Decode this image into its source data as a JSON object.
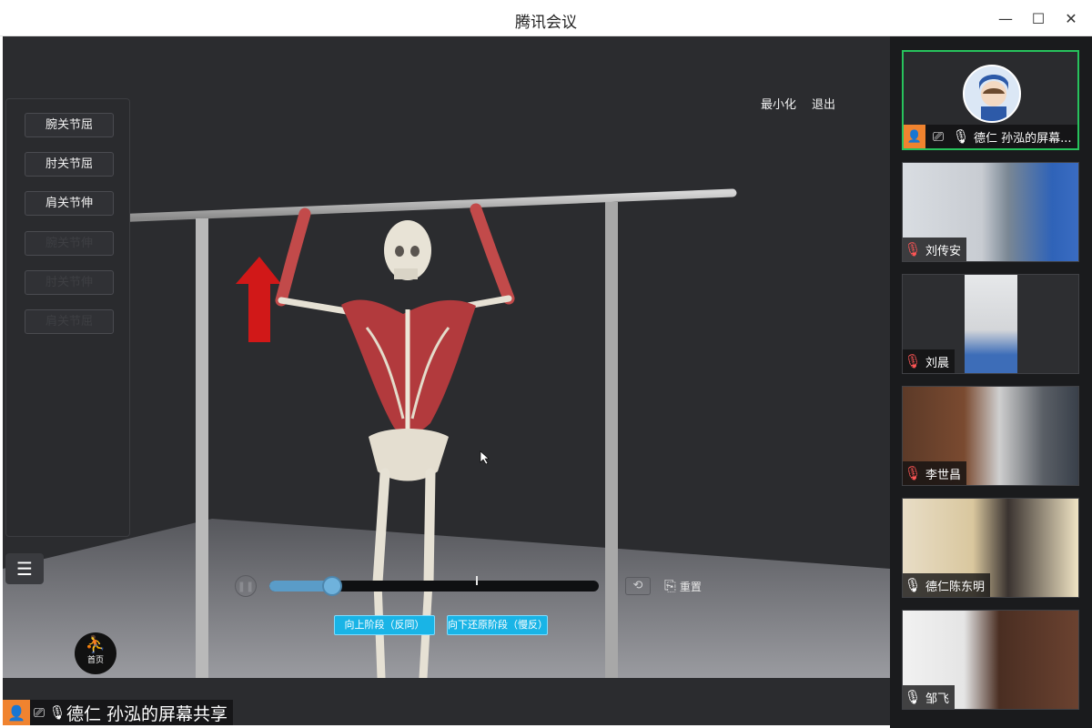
{
  "window": {
    "title": "腾讯会议"
  },
  "share": {
    "joint_buttons": [
      "腕关节屈",
      "肘关节屈",
      "肩关节伸",
      "腕关节伸",
      "肘关节伸",
      "肩关节屈"
    ],
    "top_links": {
      "minimize": "最小化",
      "exit": "退出"
    },
    "home_label": "首页",
    "progress": 0.19,
    "reset_label": "重置",
    "phase_buttons": [
      "向上阶段（反同）",
      "向下还原阶段（慢反）"
    ],
    "sharer_label": "德仁 孙泓的屏幕共享"
  },
  "participants": [
    {
      "name": "德仁 孙泓的屏幕...",
      "muted": false,
      "sharing": true
    },
    {
      "name": "刘传安",
      "muted": true
    },
    {
      "name": "刘晨",
      "muted": true
    },
    {
      "name": "李世昌",
      "muted": true
    },
    {
      "name": "德仁陈东明",
      "muted": false
    },
    {
      "name": "邹飞",
      "muted": false
    }
  ],
  "colors": {
    "accent": "#19b4e6",
    "active_border": "#27c25c",
    "share_orange": "#f0832f"
  }
}
